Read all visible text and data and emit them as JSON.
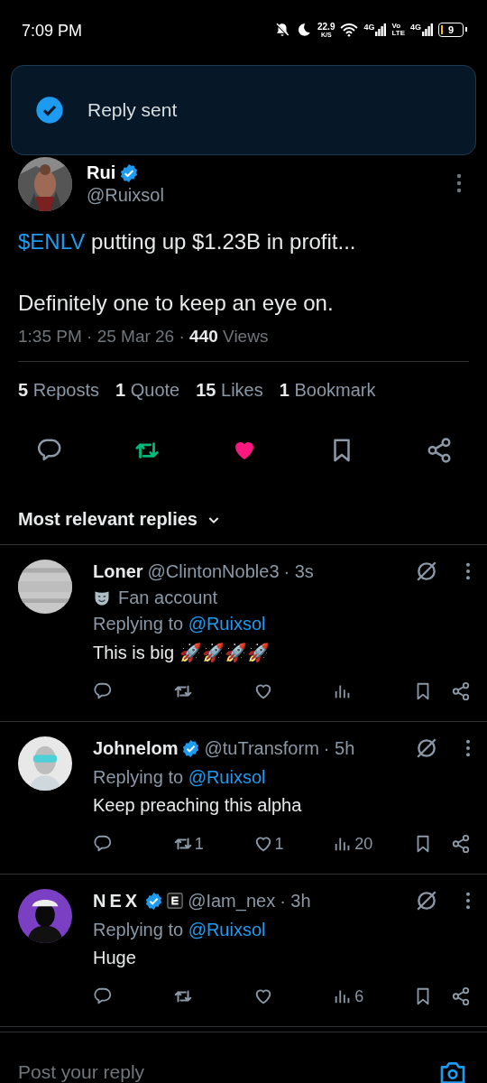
{
  "status_bar": {
    "time": "7:09 PM",
    "speed": "22.9",
    "speed_unit": "K/S",
    "sim1": "4G",
    "volte_top": "Vo",
    "volte_bottom": "LTE",
    "sim2": "4G",
    "battery": "9"
  },
  "toast": {
    "text": "Reply sent"
  },
  "post": {
    "name": "Rui",
    "verified": true,
    "handle": "@Ruixsol",
    "cashtag": "$ENLV",
    "line_1": " putting up $1.23B in profit...",
    "line_2": "Definitely one to keep an eye on.",
    "meta": "1:35 PM · 25 Mar 26 · **440** Views",
    "stats": [
      {
        "count": "5",
        "label": "Reposts"
      },
      {
        "count": "1",
        "label": "Quote"
      },
      {
        "count": "15",
        "label": "Likes"
      },
      {
        "count": "1",
        "label": "Bookmark"
      }
    ],
    "reposted": true,
    "liked": true,
    "bookmarked": false
  },
  "sort": {
    "label": "Most relevant replies"
  },
  "replies": [
    {
      "name": "Loner",
      "spaced": false,
      "verified": false,
      "affiliate": false,
      "handle": "@ClintonNoble3",
      "time": "· 3s",
      "label": "Fan account",
      "replying_prefix": "Replying to ",
      "mention": "@Ruixsol",
      "text": "This is big 🚀🚀🚀🚀",
      "reposted": false,
      "liked": false
    },
    {
      "name": "Johnelom",
      "spaced": false,
      "verified": true,
      "affiliate": false,
      "handle": "@tuTransform",
      "time": "· 5h",
      "replying_prefix": "Replying to ",
      "mention": "@Ruixsol",
      "text": "Keep preaching this alpha",
      "reposts": "1",
      "likes": "1",
      "views": "20",
      "reposted": false,
      "liked": false
    },
    {
      "name": "NEX",
      "spaced": true,
      "verified": true,
      "affiliate": true,
      "handle": "@Iam_nex",
      "time": "· 3h",
      "replying_prefix": "Replying to ",
      "mention": "@Ruixsol",
      "text": "Huge",
      "views": "6",
      "reposted": false,
      "liked": false
    }
  ],
  "composer": {
    "placeholder": "Post your reply"
  }
}
